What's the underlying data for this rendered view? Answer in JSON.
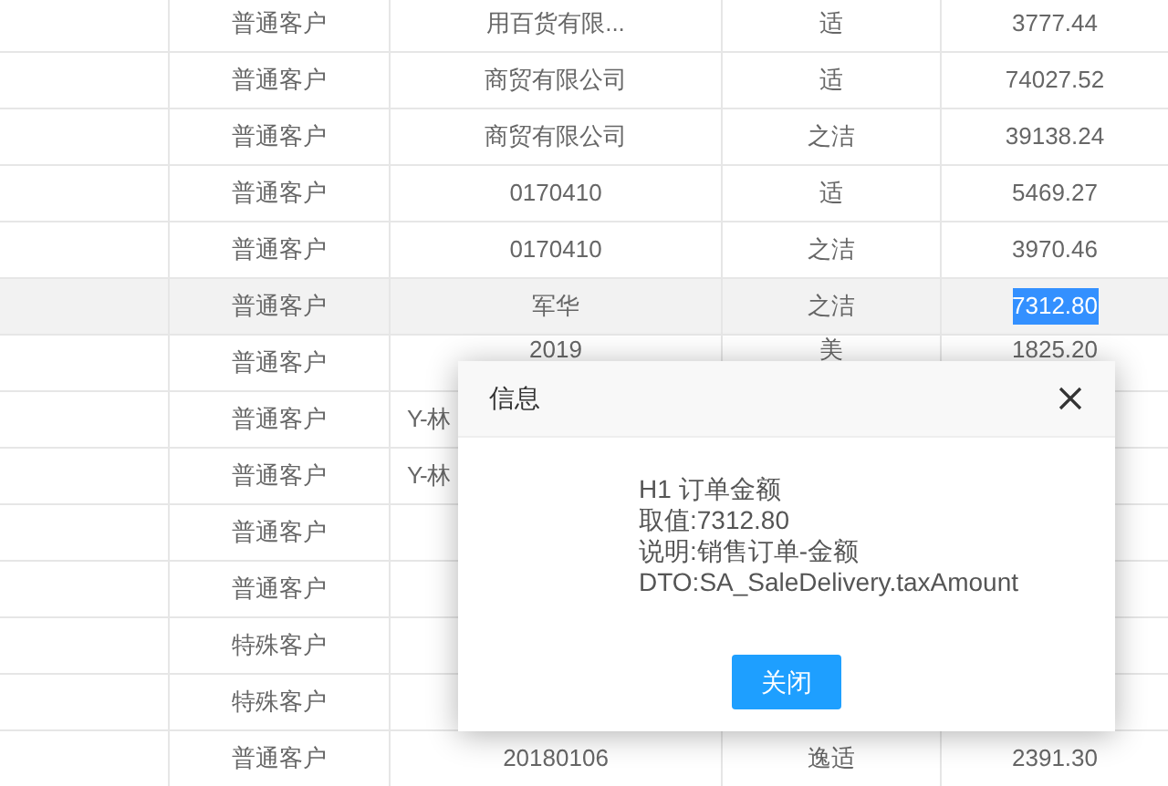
{
  "table": {
    "rows": [
      {
        "kind": "full",
        "customer_type": "普通客户",
        "name": "用百货有限...",
        "column_4": "适",
        "amount": "3777.44",
        "selected": false
      },
      {
        "kind": "full",
        "customer_type": "普通客户",
        "name": "商贸有限公司",
        "column_4": "适",
        "amount": "74027.52",
        "selected": false
      },
      {
        "kind": "full",
        "customer_type": "普通客户",
        "name": "商贸有限公司",
        "column_4": "之洁",
        "amount": "39138.24",
        "selected": false
      },
      {
        "kind": "full",
        "customer_type": "普通客户",
        "name": "0170410",
        "column_4": "适",
        "amount": "5469.27",
        "selected": false
      },
      {
        "kind": "full",
        "customer_type": "普通客户",
        "name": "0170410",
        "column_4": "之洁",
        "amount": "3970.46",
        "selected": false
      },
      {
        "kind": "full",
        "customer_type": "普通客户",
        "name": "军华",
        "column_4": "之洁",
        "amount": "7312.80",
        "selected": true
      },
      {
        "kind": "top_covered",
        "customer_type": "普通客户",
        "name": "2019",
        "column_4": "美",
        "amount": "1825.20",
        "selected": false
      },
      {
        "kind": "covered",
        "customer_type": "普通客户",
        "name": "Y-林",
        "selected": false
      },
      {
        "kind": "covered",
        "customer_type": "普通客户",
        "name": "Y-林",
        "selected": false
      },
      {
        "kind": "covered",
        "customer_type": "普通客户",
        "selected": false
      },
      {
        "kind": "covered",
        "customer_type": "普通客户",
        "selected": false
      },
      {
        "kind": "covered",
        "customer_type": "特殊客户",
        "selected": false
      },
      {
        "kind": "covered",
        "customer_type": "特殊客户",
        "selected": false
      },
      {
        "kind": "full",
        "customer_type": "普通客户",
        "name": "20180106",
        "column_4": "逸适",
        "amount": "2391.30",
        "selected": false
      }
    ]
  },
  "dialog": {
    "title": "信息",
    "lines": [
      "H1 订单金额",
      "取值:7312.80",
      "说明:销售订单-金额",
      "DTO:SA_SaleDelivery.taxAmount"
    ],
    "button": "关闭"
  }
}
